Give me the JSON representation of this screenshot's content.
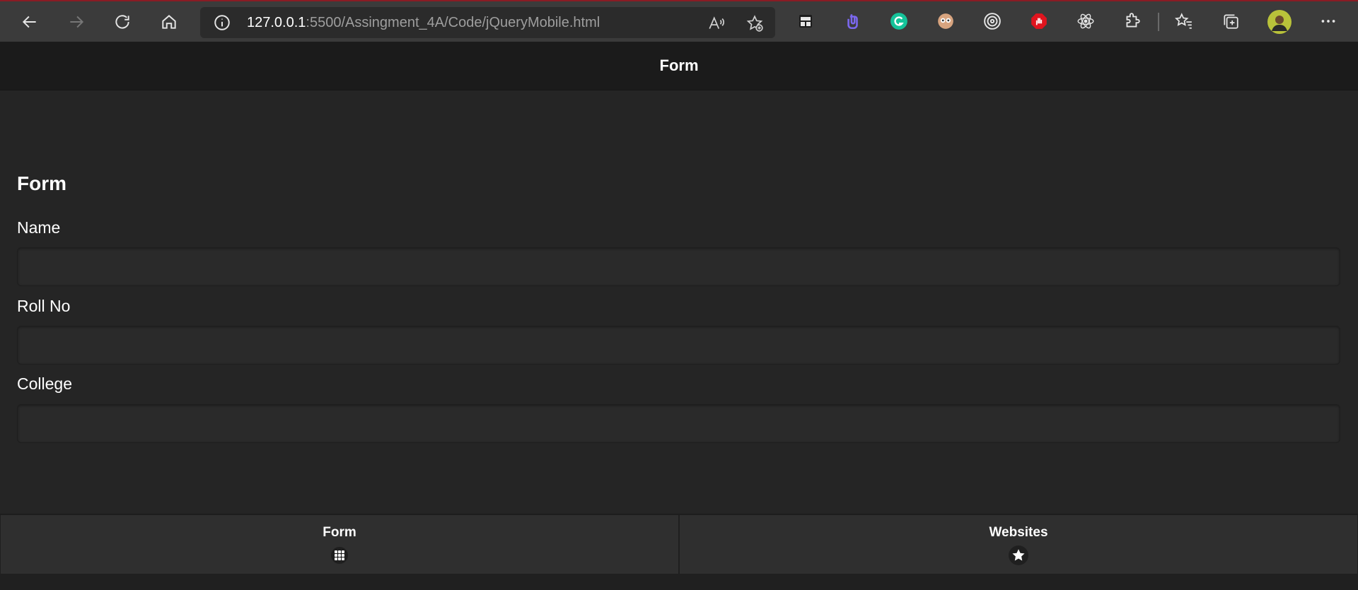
{
  "browser": {
    "url_host": "127.0.0.1",
    "url_path": ":5500/Assingment_4A/Code/jQueryMobile.html",
    "toolbar_icons": [
      "back-arrow-icon",
      "forward-arrow-icon",
      "refresh-icon",
      "home-icon",
      "info-icon",
      "read-aloud-icon",
      "add-favorite-icon"
    ],
    "extensions": [
      "reader-ext-icon",
      "clipboard-ext-icon",
      "grammarly-icon",
      "owl-ext-icon",
      "target-ext-icon",
      "adblock-icon",
      "react-devtools-icon",
      "extensions-icon",
      "favorites-icon",
      "collections-icon",
      "profile-avatar",
      "more-icon"
    ],
    "colors": {
      "grammarly": "#15c39a",
      "adblock": "#e0141e",
      "clipboard": "#7b68ee"
    }
  },
  "header": {
    "title": "Form"
  },
  "form": {
    "heading": "Form",
    "fields": [
      {
        "label": "Name",
        "value": ""
      },
      {
        "label": "Roll No",
        "value": ""
      },
      {
        "label": "College",
        "value": ""
      }
    ]
  },
  "footer": {
    "tabs": [
      {
        "label": "Form",
        "icon": "grid-icon"
      },
      {
        "label": "Websites",
        "icon": "star-icon"
      }
    ]
  }
}
